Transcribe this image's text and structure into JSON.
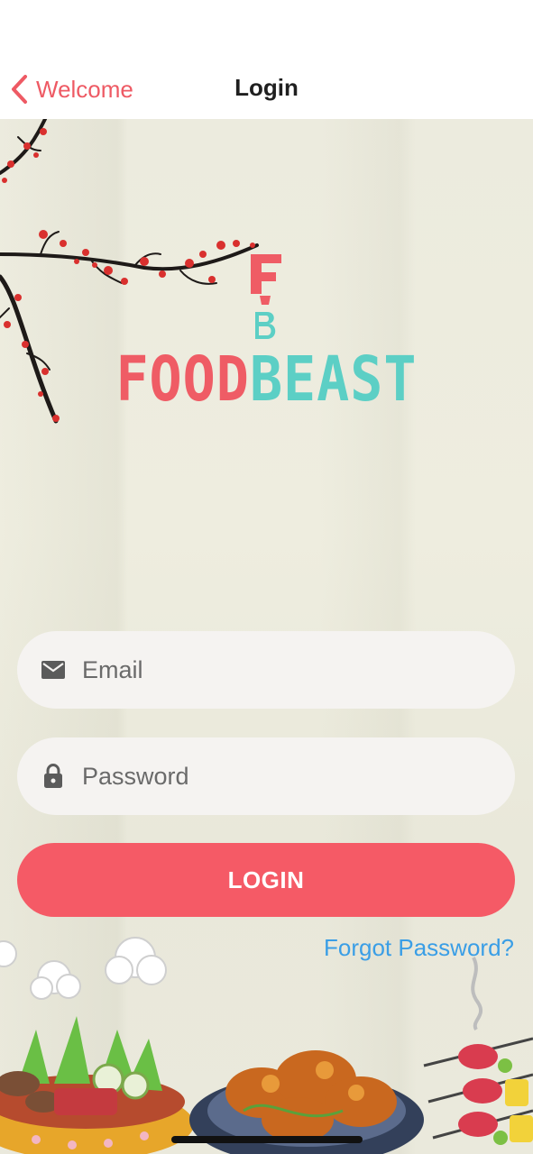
{
  "nav": {
    "back_label": "Welcome",
    "title": "Login"
  },
  "logo": {
    "mark_letters": "FB",
    "word_part1": "FOOD",
    "word_part2": "BEAST",
    "colors": {
      "red": "#ef5c65",
      "teal": "#5ccfc5"
    }
  },
  "form": {
    "email": {
      "placeholder": "Email",
      "value": "",
      "icon": "mail-icon"
    },
    "password": {
      "placeholder": "Password",
      "value": "",
      "icon": "lock-icon"
    },
    "login_label": "LOGIN",
    "forgot_label": "Forgot Password?"
  },
  "theme": {
    "accent": "#f55a66",
    "link": "#3a9ee6",
    "background": "#ecebde"
  }
}
